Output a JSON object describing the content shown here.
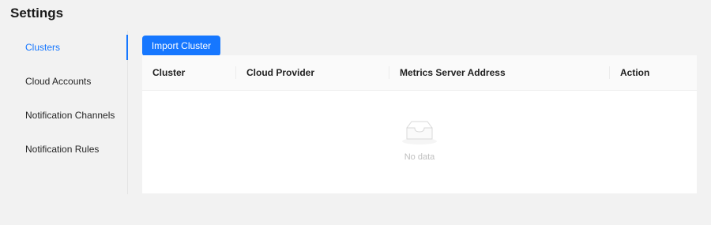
{
  "page": {
    "title": "Settings"
  },
  "sidebar": {
    "items": [
      {
        "label": "Clusters",
        "active": true
      },
      {
        "label": "Cloud Accounts",
        "active": false
      },
      {
        "label": "Notification Channels",
        "active": false
      },
      {
        "label": "Notification Rules",
        "active": false
      }
    ]
  },
  "toolbar": {
    "import_label": "Import Cluster"
  },
  "table": {
    "columns": [
      "Cluster",
      "Cloud Provider",
      "Metrics Server Address",
      "Action"
    ],
    "rows": [],
    "empty_text": "No data",
    "empty_icon": "empty-inbox-icon"
  },
  "colors": {
    "accent": "#1677ff",
    "background": "#f2f2f2",
    "table_header": "#fafafa",
    "muted_text": "#bfbfbf"
  }
}
